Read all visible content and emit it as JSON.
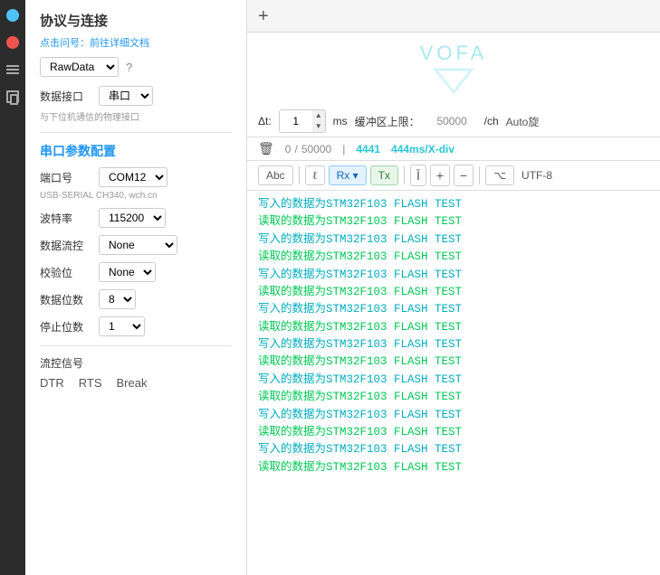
{
  "sidebar": {
    "section1": {
      "title": "协议与连接",
      "subtitle": "点击问号：前往详细文档",
      "protocol_label": "RawData",
      "question": "?",
      "interface_label": "数据接口",
      "interface_value": "串口",
      "interface_desc": "与下位机通信的物理接口"
    },
    "serial_config": {
      "title": "串口参数配置",
      "port_label": "端口号",
      "port_value": "COM12",
      "port_sub": "USB-SERIAL CH340, wch.cn",
      "baud_label": "波特率",
      "baud_value": "115200",
      "flow_label": "数据流控",
      "flow_value": "None",
      "parity_label": "校验位",
      "parity_value": "None",
      "databits_label": "数据位数",
      "databits_value": "8",
      "stopbits_label": "停止位数",
      "stopbits_value": "1",
      "flowsig_label": "流控信号",
      "dtr": "DTR",
      "rts": "RTS",
      "brk": "Break"
    }
  },
  "main": {
    "add_btn": "+",
    "vofa_text": "VOFA",
    "settings": {
      "delta_label": "Δt:",
      "delta_value": "1",
      "ms_label": "ms",
      "buffer_label": "缓冲区上限：",
      "buffer_value": "50000",
      "per_ch_label": "/ch",
      "auto_label": "Auto旋"
    },
    "status": {
      "zero": "0",
      "slash": "/",
      "total": "50000",
      "pipe": "|",
      "count": "4441",
      "rate": "444ms/X-div"
    },
    "toolbar": {
      "abc": "Abc",
      "pipe": "|",
      "cursor": "ℓ",
      "rx": "Rx",
      "tx": "Tx",
      "align": "Ī",
      "plus": "+",
      "minus": "−",
      "branch": "⌥",
      "encoding": "UTF-8"
    },
    "terminal_lines": [
      {
        "type": "write",
        "text": "写入的数据为STM32F103 FLASH TEST"
      },
      {
        "type": "read",
        "text": "读取的数据为STM32F103 FLASH TEST"
      },
      {
        "type": "write",
        "text": "写入的数据为STM32F103 FLASH TEST"
      },
      {
        "type": "read",
        "text": "读取的数据为STM32F103 FLASH TEST"
      },
      {
        "type": "write",
        "text": "写入的数据为STM32F103 FLASH TEST"
      },
      {
        "type": "read",
        "text": "读取的数据为STM32F103 FLASH TEST"
      },
      {
        "type": "write",
        "text": "写入的数据为STM32F103 FLASH TEST"
      },
      {
        "type": "read",
        "text": "读取的数据为STM32F103 FLASH TEST"
      },
      {
        "type": "write",
        "text": "写入的数据为STM32F103 FLASH TEST"
      },
      {
        "type": "read",
        "text": "读取的数据为STM32F103 FLASH TEST"
      },
      {
        "type": "write",
        "text": "写入的数据为STM32F103 FLASH TEST"
      },
      {
        "type": "read",
        "text": "读取的数据为STM32F103 FLASH TEST"
      },
      {
        "type": "write",
        "text": "写入的数据为STM32F103 FLASH TEST"
      },
      {
        "type": "read",
        "text": "读取的数据为STM32F103 FLASH TEST"
      },
      {
        "type": "write",
        "text": "写入的数据为STM32F103 FLASH TEST"
      },
      {
        "type": "read",
        "text": "读取的数据为STM32F103 FLASH TEST"
      }
    ]
  }
}
